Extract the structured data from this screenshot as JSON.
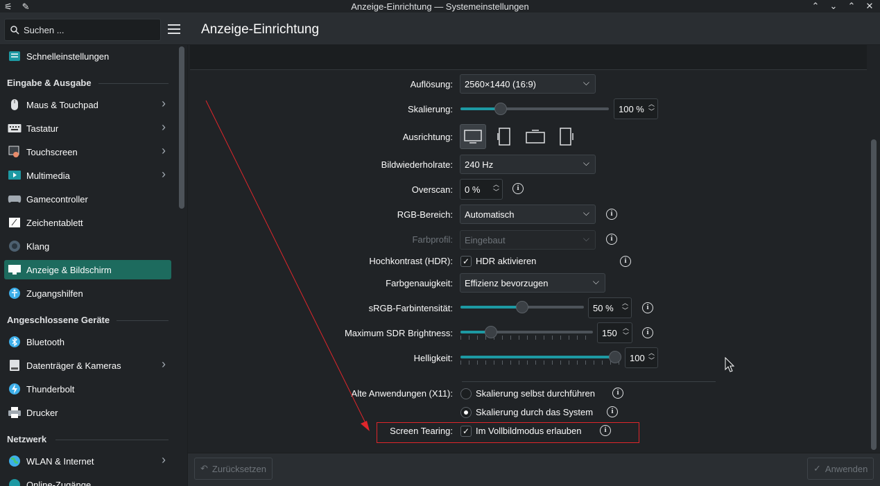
{
  "window": {
    "title": "Anzeige-Einrichtung — Systemeinstellungen"
  },
  "toolbar": {
    "search_placeholder": "Suchen ...",
    "page_title": "Anzeige-Einrichtung"
  },
  "sidebar": {
    "quick": "Schnelleinstellungen",
    "section1": "Eingabe & Ausgabe",
    "items1": [
      {
        "label": "Maus & Touchpad",
        "icon": "mouse-icon",
        "chevron": true
      },
      {
        "label": "Tastatur",
        "icon": "keyboard-icon",
        "chevron": true
      },
      {
        "label": "Touchscreen",
        "icon": "touchscreen-icon",
        "chevron": true
      },
      {
        "label": "Multimedia",
        "icon": "multimedia-icon",
        "chevron": true
      },
      {
        "label": "Gamecontroller",
        "icon": "gamepad-icon",
        "chevron": false
      },
      {
        "label": "Zeichentablett",
        "icon": "tablet-icon",
        "chevron": false
      },
      {
        "label": "Klang",
        "icon": "speaker-icon",
        "chevron": false
      },
      {
        "label": "Anzeige & Bildschirm",
        "icon": "monitor-icon",
        "chevron": false,
        "active": true
      },
      {
        "label": "Zugangshilfen",
        "icon": "accessibility-icon",
        "chevron": false
      }
    ],
    "section2": "Angeschlossene Geräte",
    "items2": [
      {
        "label": "Bluetooth",
        "icon": "bluetooth-icon",
        "chevron": false
      },
      {
        "label": "Datenträger & Kameras",
        "icon": "drive-icon",
        "chevron": true
      },
      {
        "label": "Thunderbolt",
        "icon": "thunderbolt-icon",
        "chevron": false
      },
      {
        "label": "Drucker",
        "icon": "printer-icon",
        "chevron": false
      }
    ],
    "section3": "Netzwerk",
    "items3": [
      {
        "label": "WLAN & Internet",
        "icon": "globe-icon",
        "chevron": true
      },
      {
        "label": "Online-Zugänge",
        "icon": "accounts-icon",
        "chevron": false
      }
    ]
  },
  "form": {
    "resolution": {
      "label": "Auflösung:",
      "value": "2560×1440 (16:9)"
    },
    "scaling": {
      "label": "Skalierung:",
      "value": "100 %",
      "level": 0.25
    },
    "orientation": {
      "label": "Ausrichtung:"
    },
    "refresh": {
      "label": "Bildwiederholrate:",
      "value": "240 Hz"
    },
    "overscan": {
      "label": "Overscan:",
      "value": "0 %"
    },
    "rgb": {
      "label": "RGB-Bereich:",
      "value": "Automatisch"
    },
    "profile": {
      "label": "Farbprofil:",
      "value": "Eingebaut"
    },
    "hdr": {
      "label": "Hochkontrast (HDR):",
      "option": "HDR aktivieren",
      "checked": true
    },
    "color_accuracy": {
      "label": "Farbgenauigkeit:",
      "value": "Effizienz bevorzugen"
    },
    "srgb": {
      "label": "sRGB-Farbintensität:",
      "value": "50 %",
      "level": 0.5
    },
    "sdr": {
      "label": "Maximum SDR Brightness:",
      "value": "150",
      "level": 0.2
    },
    "brightness": {
      "label": "Helligkeit:",
      "value": "100",
      "level": 1.0
    },
    "legacy": {
      "label": "Alte Anwendungen (X11):",
      "opt1": "Skalierung selbst durchführen",
      "opt2": "Skalierung durch das System",
      "selected": 2
    },
    "tearing": {
      "label": "Screen Tearing:",
      "option": "Im Vollbildmodus erlauben",
      "checked": true
    }
  },
  "footer": {
    "reset": "Zurücksetzen",
    "apply": "Anwenden"
  },
  "colors": {
    "accent": "#1d6b5e",
    "annotation": "#e0262b",
    "background": "#202326"
  }
}
